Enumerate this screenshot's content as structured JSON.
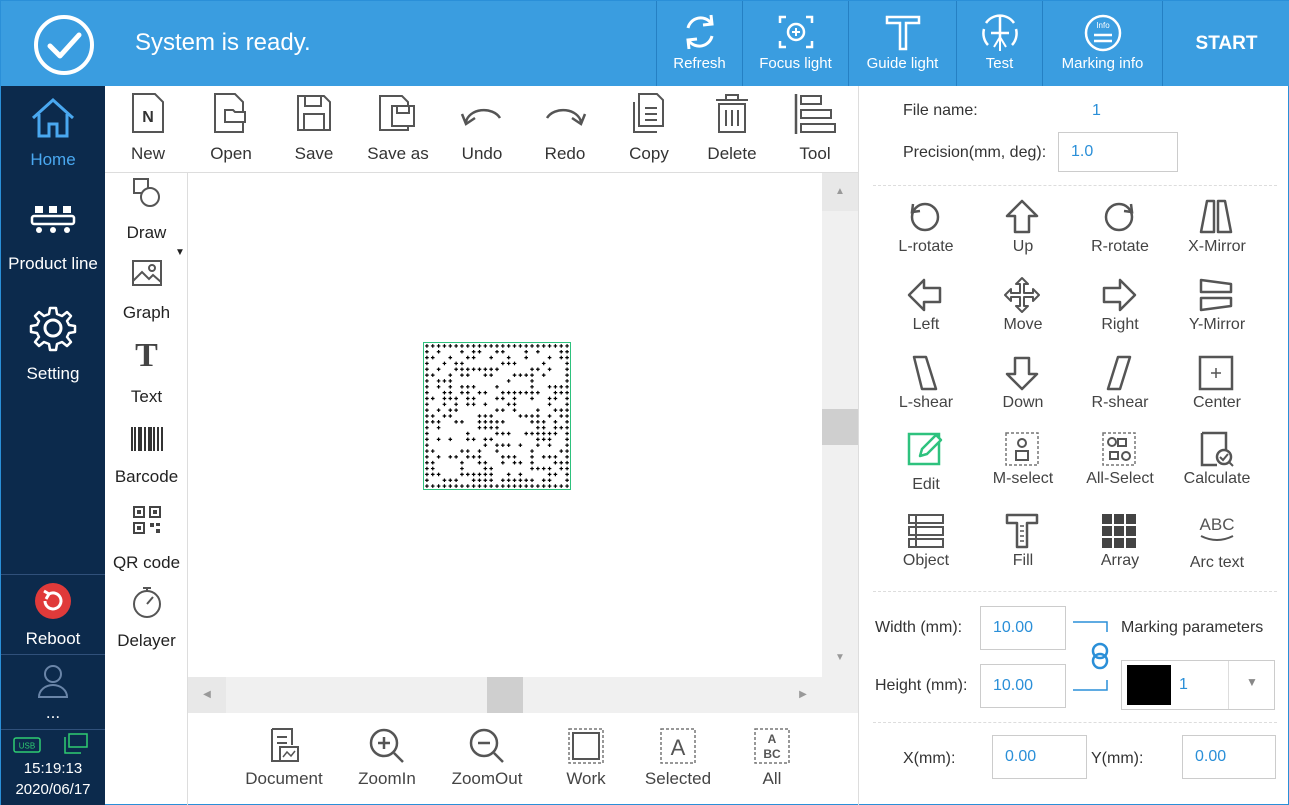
{
  "header": {
    "status_text": "System is ready.",
    "buttons": [
      {
        "label": "Refresh",
        "icon": "refresh-icon"
      },
      {
        "label": "Focus light",
        "icon": "focus-light-icon"
      },
      {
        "label": "Guide light",
        "icon": "guide-light-icon"
      },
      {
        "label": "Test",
        "icon": "test-icon"
      },
      {
        "label": "Marking info",
        "icon": "marking-info-icon"
      }
    ],
    "start_label": "START",
    "info_badge": "Info"
  },
  "sidebar": {
    "items": [
      {
        "label": "Home",
        "icon": "home-icon"
      },
      {
        "label": "Product line",
        "icon": "product-line-icon"
      },
      {
        "label": "Setting",
        "icon": "gear-icon"
      },
      {
        "label": "Reboot",
        "icon": "reboot-icon"
      },
      {
        "label": "...",
        "icon": "user-icon"
      }
    ],
    "usb_label": "USB",
    "time": "15:19:13",
    "date": "2020/06/17"
  },
  "toolbar": {
    "items": [
      {
        "label": "New"
      },
      {
        "label": "Open"
      },
      {
        "label": "Save"
      },
      {
        "label": "Save as"
      },
      {
        "label": "Undo"
      },
      {
        "label": "Redo"
      },
      {
        "label": "Copy"
      },
      {
        "label": "Delete"
      },
      {
        "label": "Tool"
      }
    ],
    "new_glyph": "N"
  },
  "palette": {
    "items": [
      {
        "label": "Draw"
      },
      {
        "label": "Graph"
      },
      {
        "label": "Text"
      },
      {
        "label": "Barcode"
      },
      {
        "label": "QR code"
      },
      {
        "label": "Delayer"
      }
    ],
    "text_glyph": "T"
  },
  "view": {
    "items": [
      {
        "label": "Document"
      },
      {
        "label": "ZoomIn"
      },
      {
        "label": "ZoomOut"
      },
      {
        "label": "Work"
      },
      {
        "label": "Selected"
      },
      {
        "label": "All"
      }
    ],
    "selected_glyph": "A",
    "all_glyph_top": "A",
    "all_glyph_bottom": "BC"
  },
  "properties": {
    "file_name_label": "File name:",
    "file_name": "1",
    "precision_label": "Precision(mm, deg):",
    "precision": "1.0",
    "operations": [
      {
        "label": "L-rotate"
      },
      {
        "label": "Up"
      },
      {
        "label": "R-rotate"
      },
      {
        "label": "X-Mirror"
      },
      {
        "label": "Left"
      },
      {
        "label": "Move"
      },
      {
        "label": "Right"
      },
      {
        "label": "Y-Mirror"
      },
      {
        "label": "L-shear"
      },
      {
        "label": "Down"
      },
      {
        "label": "R-shear"
      },
      {
        "label": "Center"
      },
      {
        "label": "Edit"
      },
      {
        "label": "M-select"
      },
      {
        "label": "All-Select"
      },
      {
        "label": "Calculate"
      },
      {
        "label": "Object"
      },
      {
        "label": "Fill"
      },
      {
        "label": "Array"
      },
      {
        "label": "Arc text"
      }
    ],
    "arc_glyph": "ABC",
    "width_label": "Width (mm):",
    "width": "10.00",
    "height_label": "Height (mm):",
    "height": "10.00",
    "marking_params_label": "Marking parameters",
    "marking_param_value": "1",
    "x_label": "X(mm):",
    "x": "0.00",
    "y_label": "Y(mm):",
    "y": "0.00"
  }
}
